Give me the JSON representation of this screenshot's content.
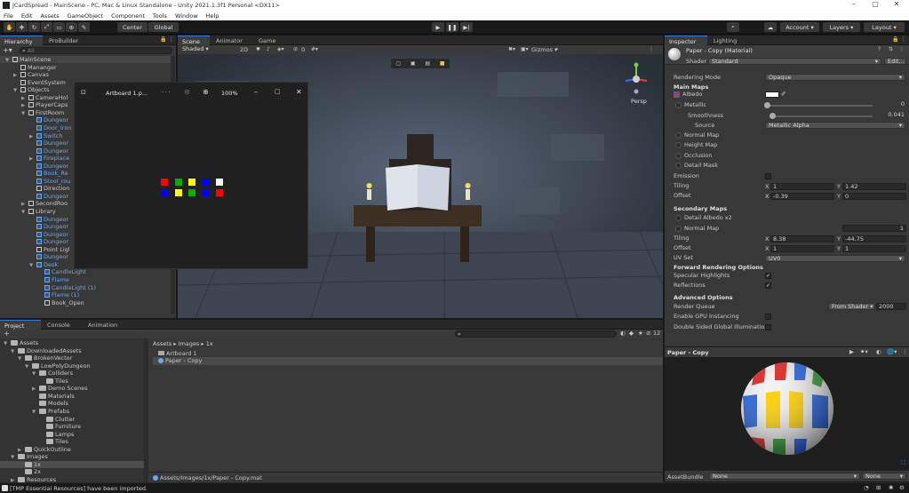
{
  "window": {
    "title": "JCardSpread - MainScene - PC, Mac & Linux Standalone - Unity 2021.1.3f1 Personal <DX11>",
    "menu": [
      "File",
      "Edit",
      "Assets",
      "GameObject",
      "Component",
      "Tools",
      "Window",
      "Help"
    ]
  },
  "toolbar": {
    "center_label": "Center",
    "global_label": "Global",
    "account_label": "Account",
    "layers_label": "Layers",
    "layout_label": "Layout"
  },
  "hierarchy": {
    "tabs": [
      "Hierarchy",
      "ProBuilder"
    ],
    "search_placeholder": "All",
    "items": [
      {
        "label": "MainScene",
        "indent": 0,
        "blue": false,
        "arrow": "▼",
        "icon": "scene"
      },
      {
        "label": "Mananger",
        "indent": 1,
        "blue": false,
        "arrow": "",
        "icon": "cube"
      },
      {
        "label": "Canvas",
        "indent": 1,
        "blue": false,
        "arrow": "▶",
        "icon": "cube"
      },
      {
        "label": "EventSystem",
        "indent": 1,
        "blue": false,
        "arrow": "",
        "icon": "cube"
      },
      {
        "label": "Objects",
        "indent": 1,
        "blue": false,
        "arrow": "▼",
        "icon": "cube"
      },
      {
        "label": "CameraHol",
        "indent": 2,
        "blue": false,
        "arrow": "▶",
        "icon": "cube"
      },
      {
        "label": "PlayerCaps",
        "indent": 2,
        "blue": false,
        "arrow": "▶",
        "icon": "cube"
      },
      {
        "label": "FirstRoom",
        "indent": 2,
        "blue": false,
        "arrow": "▼",
        "icon": "cube"
      },
      {
        "label": "Dungeor",
        "indent": 3,
        "blue": true,
        "arrow": "",
        "icon": "cube"
      },
      {
        "label": "Door_Iron",
        "indent": 3,
        "blue": true,
        "arrow": "",
        "icon": "cube"
      },
      {
        "label": "Switch",
        "indent": 3,
        "blue": true,
        "arrow": "▶",
        "icon": "cube"
      },
      {
        "label": "Dungeor",
        "indent": 3,
        "blue": true,
        "arrow": "",
        "icon": "cube"
      },
      {
        "label": "Dungeor",
        "indent": 3,
        "blue": true,
        "arrow": "",
        "icon": "cube"
      },
      {
        "label": "Fireplace",
        "indent": 3,
        "blue": true,
        "arrow": "▶",
        "icon": "cube"
      },
      {
        "label": "Dungeor",
        "indent": 3,
        "blue": true,
        "arrow": "",
        "icon": "cube"
      },
      {
        "label": "Book_Re",
        "indent": 3,
        "blue": true,
        "arrow": "",
        "icon": "cube"
      },
      {
        "label": "Stool_rou",
        "indent": 3,
        "blue": true,
        "arrow": "",
        "icon": "cube"
      },
      {
        "label": "Direction",
        "indent": 3,
        "blue": false,
        "arrow": "",
        "icon": "cube"
      },
      {
        "label": "Dungeor",
        "indent": 3,
        "blue": true,
        "arrow": "",
        "icon": "cube"
      },
      {
        "label": "SecondRoo",
        "indent": 2,
        "blue": false,
        "arrow": "▶",
        "icon": "cube"
      },
      {
        "label": "Library",
        "indent": 2,
        "blue": false,
        "arrow": "▼",
        "icon": "cube"
      },
      {
        "label": "Dungeor",
        "indent": 3,
        "blue": true,
        "arrow": "",
        "icon": "cube"
      },
      {
        "label": "Dungeor",
        "indent": 3,
        "blue": true,
        "arrow": "",
        "icon": "cube"
      },
      {
        "label": "Dungeor",
        "indent": 3,
        "blue": true,
        "arrow": "",
        "icon": "cube"
      },
      {
        "label": "Dungeor",
        "indent": 3,
        "blue": true,
        "arrow": "",
        "icon": "cube"
      },
      {
        "label": "Point Ligl",
        "indent": 3,
        "blue": false,
        "arrow": "",
        "icon": "cube"
      },
      {
        "label": "Dungeor",
        "indent": 3,
        "blue": true,
        "arrow": "",
        "icon": "cube"
      },
      {
        "label": "Desk",
        "indent": 3,
        "blue": true,
        "arrow": "▼",
        "icon": "cube"
      },
      {
        "label": "CandleLight",
        "indent": 4,
        "blue": true,
        "arrow": "",
        "icon": "cube"
      },
      {
        "label": "Flame",
        "indent": 4,
        "blue": true,
        "arrow": "",
        "icon": "cube"
      },
      {
        "label": "CandleLight (1)",
        "indent": 4,
        "blue": true,
        "arrow": "",
        "icon": "cube"
      },
      {
        "label": "Flame (1)",
        "indent": 4,
        "blue": true,
        "arrow": "",
        "icon": "cube"
      },
      {
        "label": "Book_Open",
        "indent": 4,
        "blue": false,
        "arrow": "",
        "icon": "cube"
      }
    ]
  },
  "scene": {
    "tabs": [
      "Scene",
      "Animator",
      "Game"
    ],
    "shading": "Shaded",
    "mode_2d": "2D",
    "gizmos_label": "Gizmos",
    "hidden_count": "0",
    "persp_label": "Persp"
  },
  "photo_viewer": {
    "title": "Artboard 1.p...",
    "more": "· · ·",
    "zoom": "100%",
    "tiles": [
      [
        "#ff0000",
        "#00b000",
        "#ffff00",
        "#0000ff",
        "#ffffff"
      ],
      [
        "#0000ff",
        "#ffff00",
        "#00b000",
        "#0000ff",
        "#ff0000"
      ]
    ]
  },
  "inspector": {
    "tabs": [
      "Inspector",
      "Lighting"
    ],
    "material_name": "Paper - Copy (Material)",
    "shader_label": "Shader",
    "shader_value": "Standard",
    "edit_label": "Edit...",
    "rendering_mode_label": "Rendering Mode",
    "rendering_mode_value": "Opaque",
    "main_maps": "Main Maps",
    "albedo": "Albedo",
    "metallic": "Metallic",
    "metallic_value": "0",
    "smoothness": "Smoothness",
    "smoothness_value": "0.041",
    "source": "Source",
    "source_value": "Metallic Alpha",
    "normal_map": "Normal Map",
    "height_map": "Height Map",
    "occlusion": "Occlusion",
    "detail_mask": "Detail Mask",
    "emission": "Emission",
    "tiling": "Tiling",
    "tiling_x": "1",
    "tiling_y": "1.42",
    "offset": "Offset",
    "offset_x": "-0.39",
    "offset_y": "0",
    "secondary_maps": "Secondary Maps",
    "detail_albedo": "Detail Albedo x2",
    "normal_map2": "Normal Map",
    "normal_map2_value": "1",
    "tiling2_x": "8.38",
    "tiling2_y": "-44.75",
    "offset2_x": "1",
    "offset2_y": "1",
    "uv_set": "UV Set",
    "uv_set_value": "UV0",
    "forward_options": "Forward Rendering Options",
    "specular": "Specular Highlights",
    "reflections": "Reflections",
    "advanced": "Advanced Options",
    "render_queue": "Render Queue",
    "render_queue_mode": "From Shader",
    "render_queue_value": "2000",
    "gpu_instancing": "Enable GPU Instancing",
    "double_sided": "Double Sided Global Illumination",
    "x_label": "X",
    "y_label": "Y"
  },
  "preview": {
    "title": "Paper - Copy",
    "assetbundle_label": "AssetBundle",
    "assetbundle_value": "None",
    "variant_value": "None"
  },
  "project": {
    "tabs": [
      "Project",
      "Console",
      "Animation"
    ],
    "add_label": "+",
    "hidden_count": "12",
    "tree": [
      {
        "label": "Assets",
        "indent": 0,
        "arrow": "▼"
      },
      {
        "label": "DownloadedAssets",
        "indent": 1,
        "arrow": "▼"
      },
      {
        "label": "BrokenVector",
        "indent": 2,
        "arrow": "▼"
      },
      {
        "label": "LowPolyDungeon",
        "indent": 3,
        "arrow": "▼"
      },
      {
        "label": "Colliders",
        "indent": 4,
        "arrow": "▼"
      },
      {
        "label": "Tiles",
        "indent": 5,
        "arrow": ""
      },
      {
        "label": "Demo Scenes",
        "indent": 4,
        "arrow": "▶"
      },
      {
        "label": "Materials",
        "indent": 4,
        "arrow": ""
      },
      {
        "label": "Models",
        "indent": 4,
        "arrow": ""
      },
      {
        "label": "Prefabs",
        "indent": 4,
        "arrow": "▼"
      },
      {
        "label": "Clutter",
        "indent": 5,
        "arrow": ""
      },
      {
        "label": "Furniture",
        "indent": 5,
        "arrow": ""
      },
      {
        "label": "Lamps",
        "indent": 5,
        "arrow": ""
      },
      {
        "label": "Tiles",
        "indent": 5,
        "arrow": ""
      },
      {
        "label": "QuickOutline",
        "indent": 2,
        "arrow": "▶"
      },
      {
        "label": "Images",
        "indent": 1,
        "arrow": "▼"
      },
      {
        "label": "1x",
        "indent": 2,
        "arrow": "",
        "selected": true
      },
      {
        "label": "2x",
        "indent": 2,
        "arrow": ""
      },
      {
        "label": "Resources",
        "indent": 1,
        "arrow": "▶"
      }
    ],
    "breadcrumb": [
      "Assets",
      "Images",
      "1x"
    ],
    "files": [
      "Artboard 1",
      "Paper - Copy"
    ],
    "path": "Assets/Images/1x/Paper - Copy.mat"
  },
  "status": {
    "message": "[TMP Essential Resources] have been imported."
  }
}
